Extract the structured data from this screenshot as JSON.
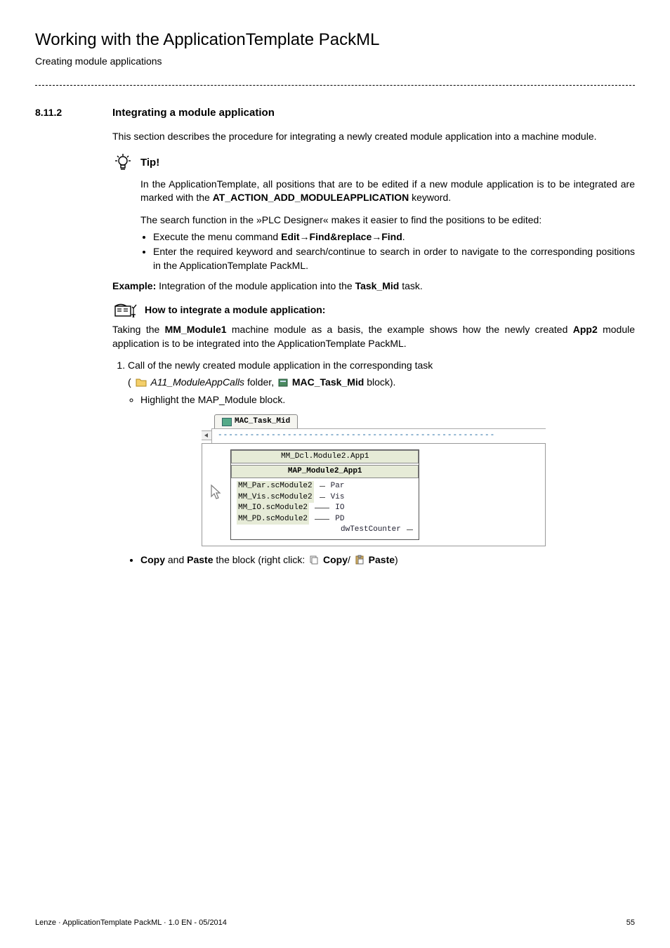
{
  "header": {
    "title": "Working with the ApplicationTemplate PackML",
    "subtitle": "Creating module applications"
  },
  "section": {
    "number": "8.11.2",
    "heading": "Integrating a module application"
  },
  "intro": "This section describes the procedure for integrating a newly created module application into a machine module.",
  "tip": {
    "label": "Tip!",
    "p1_a": "In the ApplicationTemplate, all positions that are to be edited if a new module application is to be integrated are marked with the ",
    "p1_b": "AT_ACTION_ADD_MODULEAPPLICATION",
    "p1_c": " keyword.",
    "p2": "The search function in the »PLC Designer« makes it easier to find the positions to be edited:",
    "li1_a": "Execute the menu command ",
    "li1_b": "Edit→Find&replace→Find",
    "li1_c": ".",
    "li2": "Enter the required keyword and search/continue to search in order to navigate to the corresponding positions in the ApplicationTemplate PackML."
  },
  "example": {
    "label": "Example:",
    "text_a": " Integration of the module application into the ",
    "text_b": "Task_Mid",
    "text_c": " task."
  },
  "howto": {
    "label": "How to integrate a module application:",
    "p_a": "Taking the ",
    "p_b": "MM_Module1",
    "p_c": " machine module as a basis, the example shows how the newly created ",
    "p_d": "App2",
    "p_e": " module application is to be integrated into the ApplicationTemplate PackML.",
    "step1": "Call of the newly created module application in the corresponding task",
    "step1_sub_a": "(",
    "step1_sub_b": "A11_ModuleAppCalls",
    "step1_sub_c": " folder, ",
    "step1_sub_d": "MAC_Task_Mid",
    "step1_sub_e": " block).",
    "bullet_hl": "Highlight the MAP_Module block.",
    "bullet_cp_a": "Copy",
    "bullet_cp_b": " and ",
    "bullet_cp_c": "Paste",
    "bullet_cp_d": " the block (right click: ",
    "bullet_cp_e": "Copy",
    "bullet_cp_f": "/",
    "bullet_cp_g": "Paste",
    "bullet_cp_h": ")"
  },
  "screenshot": {
    "tab": "MAC_Task_Mid",
    "dash": "----------------------------------------------------",
    "head1": "MM_Dcl.Module2.App1",
    "head2": "MAP_Module2_App1",
    "l1_left": "MM_Par.scModule2",
    "l1_pin": "Par",
    "l2_left": "MM_Vis.scModule2",
    "l2_pin": "Vis",
    "l3_left": "MM_IO.scModule2",
    "l3_pin": "IO",
    "l4_left": "MM_PD.scModule2",
    "l4_pin": "PD",
    "out_pin": "dwTestCounter"
  },
  "footer": {
    "left": "Lenze · ApplicationTemplate PackML · 1.0 EN - 05/2014",
    "right": "55"
  }
}
